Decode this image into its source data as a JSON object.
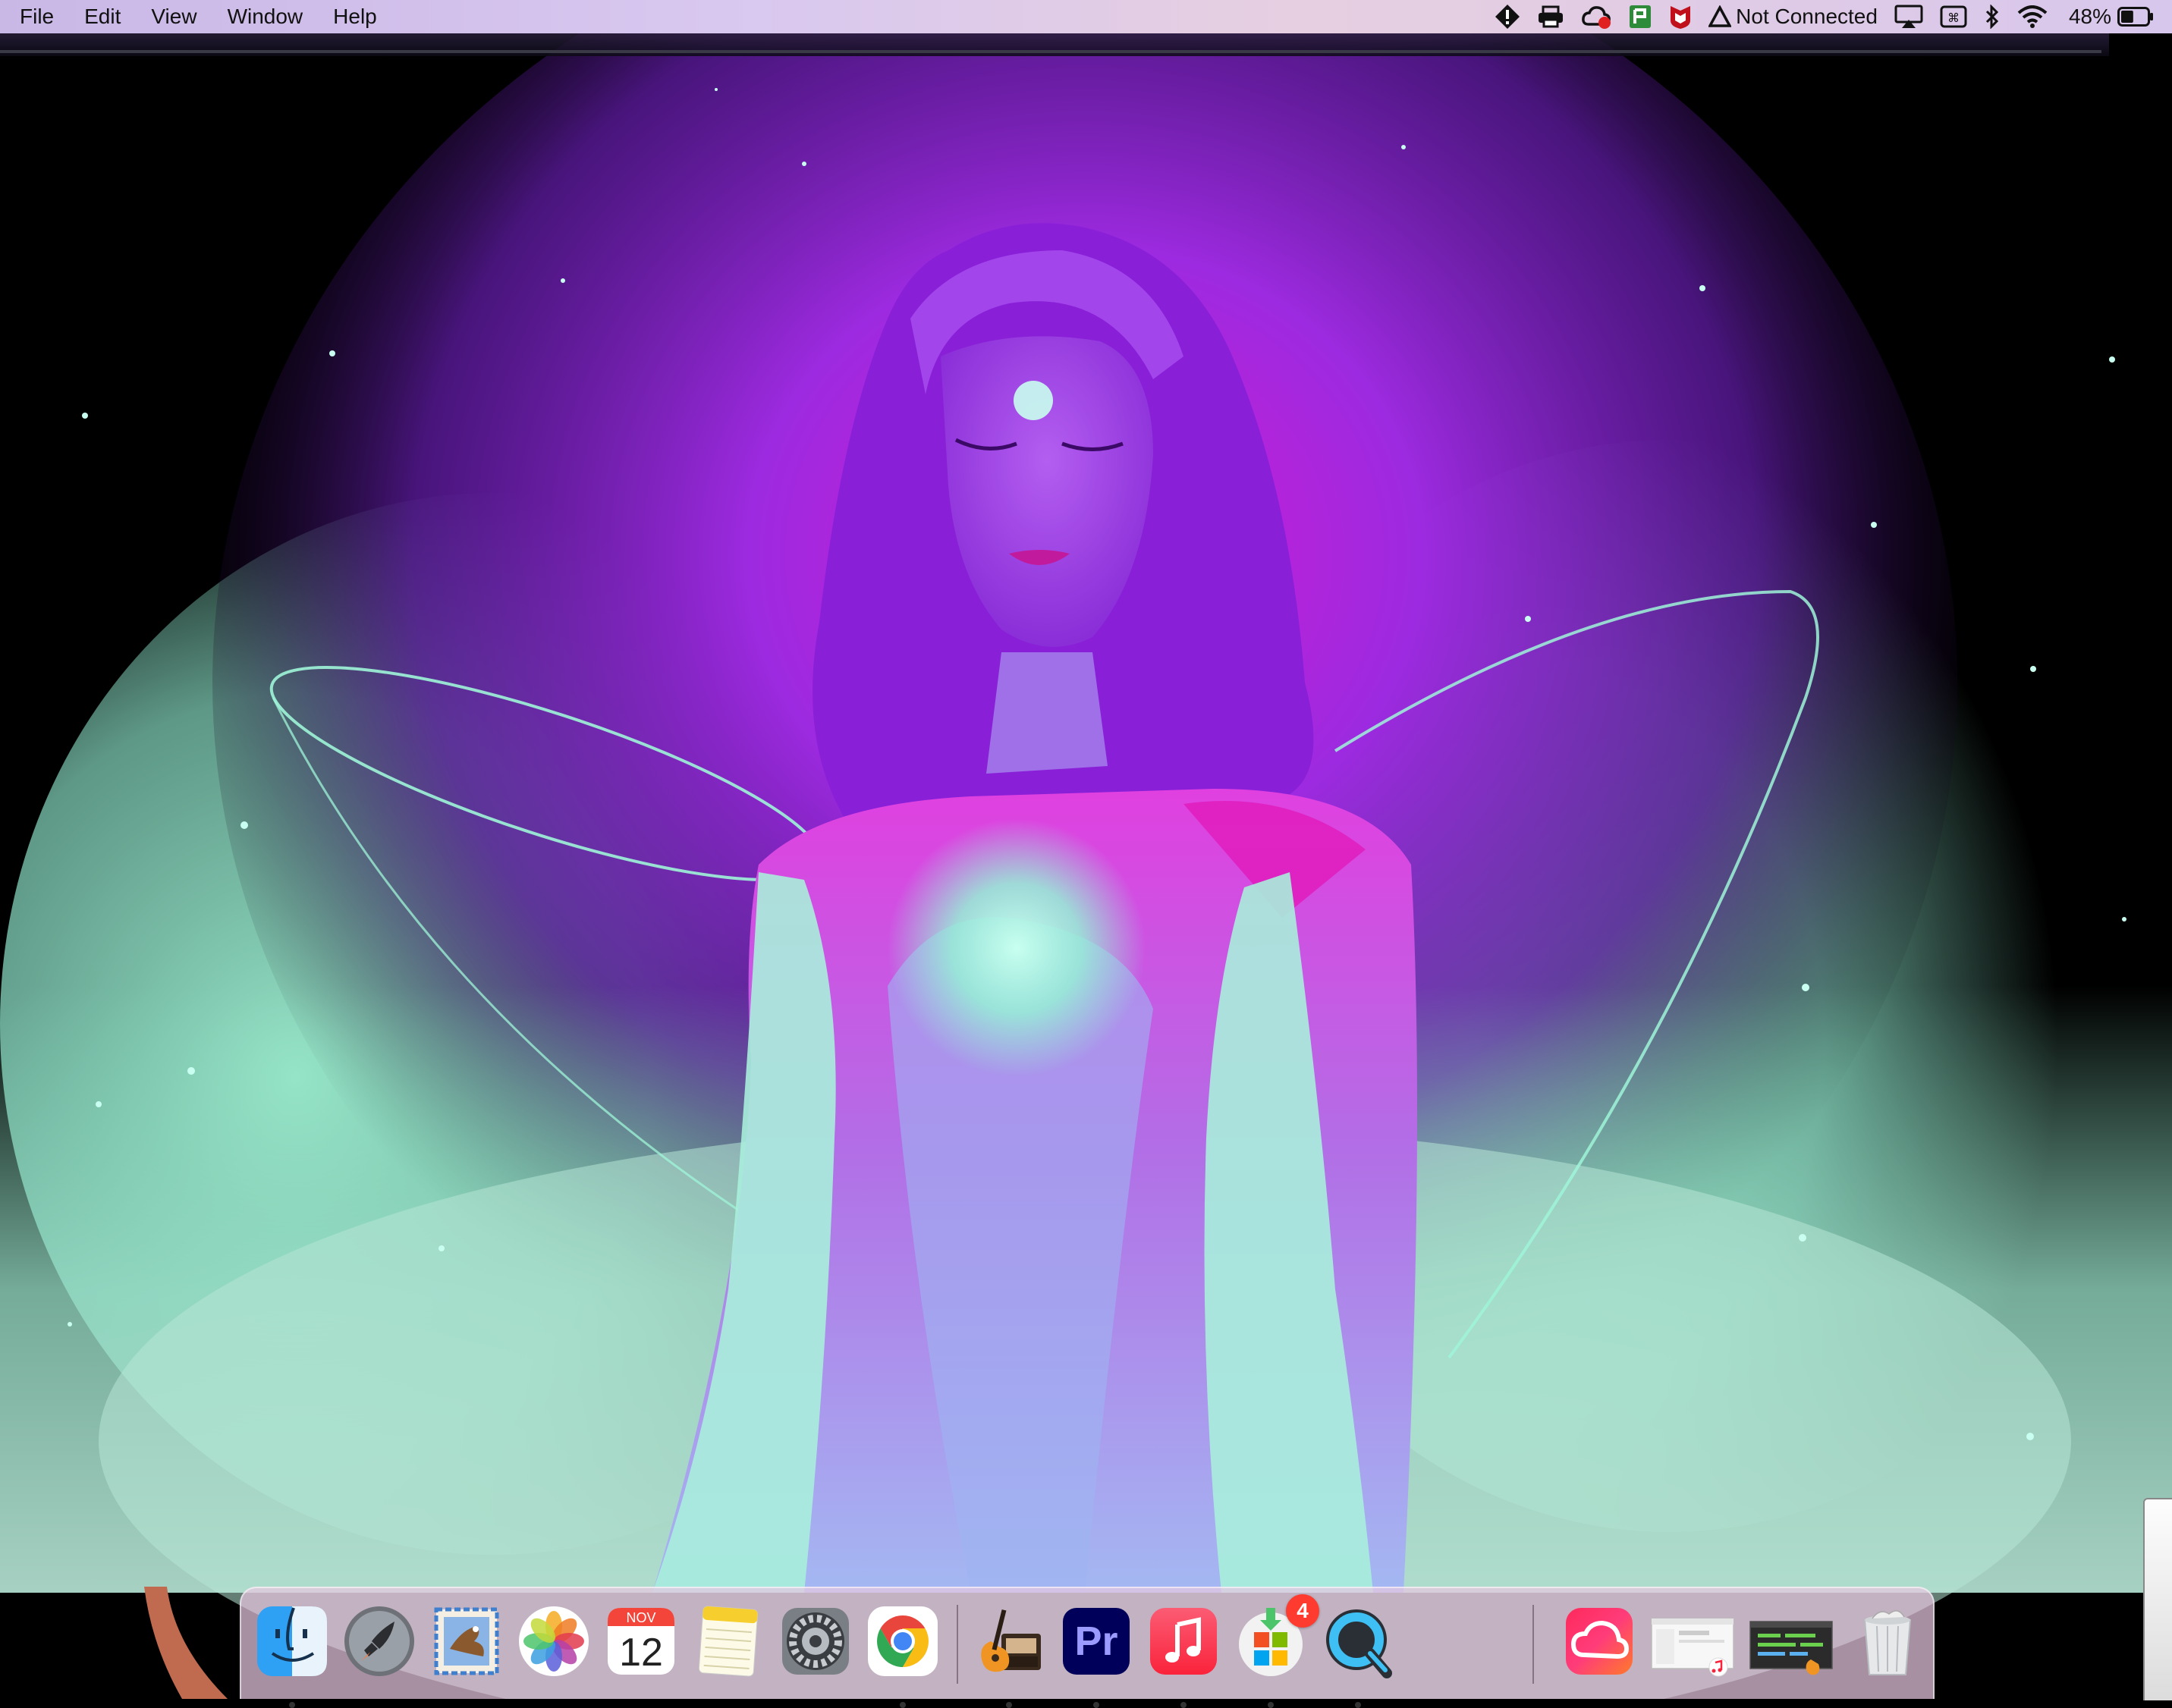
{
  "menubar": {
    "menus": [
      "File",
      "Edit",
      "View",
      "Window",
      "Help"
    ],
    "status": {
      "vpn_label": "Not Connected",
      "battery_percent": "48%",
      "icons": [
        "alert-icon",
        "printer-icon",
        "creative-cloud-sync-icon",
        "green-status-icon",
        "mcafee-icon",
        "vpn-icon",
        "airplay-icon",
        "keyboard-shortcut-icon",
        "bluetooth-icon",
        "wifi-icon",
        "battery-icon"
      ],
      "battery_level": 0.48
    }
  },
  "dock": {
    "apps": [
      {
        "name": "Finder",
        "icon": "finder-icon",
        "running": true
      },
      {
        "name": "Launchpad",
        "icon": "launchpad-icon",
        "running": false
      },
      {
        "name": "Mail",
        "icon": "mail-icon",
        "running": false
      },
      {
        "name": "Photos",
        "icon": "photos-icon",
        "running": false
      },
      {
        "name": "Calendar",
        "icon": "calendar-icon",
        "running": false,
        "month": "NOV",
        "day": "12"
      },
      {
        "name": "Notes",
        "icon": "notes-icon",
        "running": false
      },
      {
        "name": "System Preferences",
        "icon": "system-preferences-icon",
        "running": false
      },
      {
        "name": "Google Chrome",
        "icon": "chrome-icon",
        "running": true
      },
      {
        "name": "GarageBand",
        "icon": "garageband-icon",
        "running": true
      },
      {
        "name": "Adobe Premiere Pro",
        "icon": "premiere-icon",
        "running": true,
        "label": "Pr"
      },
      {
        "name": "Music",
        "icon": "music-icon",
        "running": true
      },
      {
        "name": "Microsoft AutoUpdate",
        "icon": "microsoft-autoupdate-icon",
        "running": true,
        "badge": "4"
      },
      {
        "name": "QuickTime Player",
        "icon": "quicktime-icon",
        "running": true
      },
      {
        "name": "Adobe Creative Cloud",
        "icon": "creative-cloud-icon",
        "running": false
      },
      {
        "name": "Music window",
        "icon": "minimized-music-window-icon",
        "running": false
      },
      {
        "name": "GarageBand window",
        "icon": "minimized-garageband-window-icon",
        "running": false
      },
      {
        "name": "Trash",
        "icon": "trash-icon",
        "running": false
      }
    ]
  },
  "colors": {
    "wallpaper_purple": "#9a2bd6",
    "wallpaper_magenta": "#d11bd3",
    "wallpaper_mint": "#8de8c8",
    "menubar": "#d3c2ec"
  }
}
